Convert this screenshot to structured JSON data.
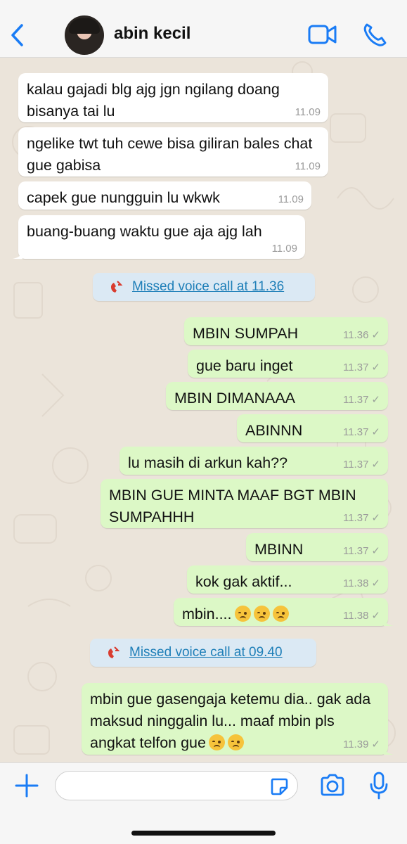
{
  "header": {
    "contact_name": "abin kecil",
    "back_icon": "chevron-left-icon",
    "video_icon": "video-camera-icon",
    "phone_icon": "phone-icon"
  },
  "colors": {
    "accent": "#1a7cf5",
    "incoming_bubble": "#ffffff",
    "outgoing_bubble": "#dcf8c6",
    "missed_call_bg": "#dbe9f4",
    "missed_call_text": "#1f7fb8",
    "missed_call_icon": "#d93c2f"
  },
  "messages": [
    {
      "type": "incoming",
      "text": "kalau gajadi blg ajg jgn ngilang doang bisanya tai lu",
      "time": "11.09"
    },
    {
      "type": "incoming",
      "text": "ngelike twt tuh cewe bisa giliran bales chat gue gabisa",
      "time": "11.09"
    },
    {
      "type": "incoming",
      "text": "capek gue nungguin lu wkwk",
      "time": "11.09"
    },
    {
      "type": "incoming",
      "text": "buang-buang waktu gue aja ajg lah",
      "time": "11.09"
    },
    {
      "type": "missed_call",
      "text": "Missed voice call at 11.36"
    },
    {
      "type": "outgoing",
      "text": "MBIN SUMPAH",
      "time": "11.36"
    },
    {
      "type": "outgoing",
      "text": "gue baru inget",
      "time": "11.37"
    },
    {
      "type": "outgoing",
      "text": "MBIN DIMANAAA",
      "time": "11.37"
    },
    {
      "type": "outgoing",
      "text": "ABINNN",
      "time": "11.37"
    },
    {
      "type": "outgoing",
      "text": "lu masih di arkun kah??",
      "time": "11.37"
    },
    {
      "type": "outgoing",
      "text": "MBIN GUE MINTA MAAF BGT MBIN SUMPAHHH",
      "time": "11.37"
    },
    {
      "type": "outgoing",
      "text": "MBINN",
      "time": "11.37"
    },
    {
      "type": "outgoing",
      "text": "kok gak aktif...",
      "time": "11.38"
    },
    {
      "type": "outgoing",
      "text": "mbin....",
      "time": "11.38",
      "emoji": [
        "pensive-face",
        "pensive-face",
        "pensive-face"
      ]
    },
    {
      "type": "missed_call",
      "text": "Missed voice call at 09.40"
    },
    {
      "type": "outgoing",
      "text": "mbin gue gasengaja ketemu dia.. gak ada maksud ninggalin lu... maaf mbin pls angkat telfon gue",
      "time": "11.39",
      "emoji": [
        "pensive-face",
        "pensive-face"
      ]
    }
  ],
  "composer": {
    "plus_icon": "plus-icon",
    "sticker_icon": "sticker-icon",
    "camera_icon": "camera-icon",
    "mic_icon": "microphone-icon",
    "placeholder": ""
  }
}
